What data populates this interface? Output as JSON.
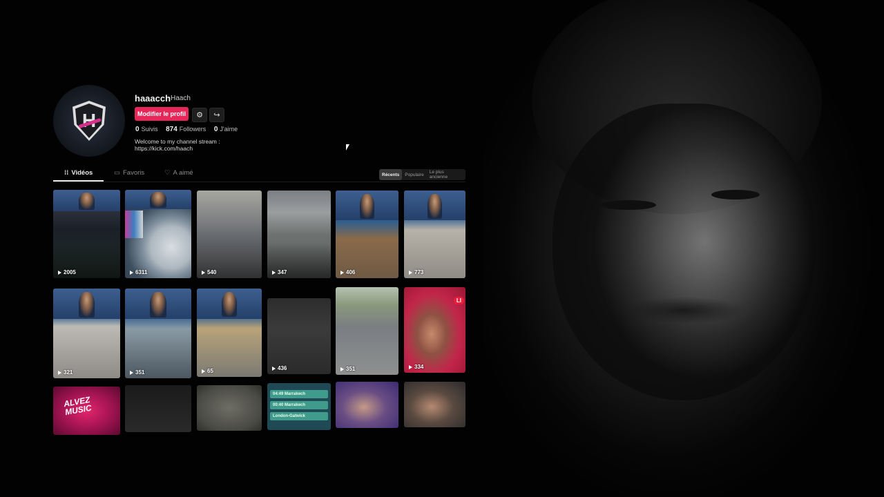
{
  "profile": {
    "username": "haaacch",
    "nickname": "Haach",
    "edit_button": "Modifier le profil",
    "stats": {
      "following_count": "0",
      "following_label": "Suivis",
      "followers_count": "874",
      "followers_label": "Followers",
      "likes_count": "0",
      "likes_label": "J'aime"
    },
    "bio_line1": "Welcome to my channel stream :",
    "bio_line2": "https://kick.com/haach"
  },
  "tabs": [
    {
      "label": "Vidéos",
      "icon": "grid-icon",
      "active": true
    },
    {
      "label": "Favoris",
      "icon": "bookmark-icon",
      "active": false
    },
    {
      "label": "A aimé",
      "icon": "heart-icon",
      "active": false
    }
  ],
  "sort": {
    "options": [
      "Récents",
      "Populaire",
      "Le plus ancienne"
    ],
    "selected": "Récents"
  },
  "videos": [
    {
      "views": "2005"
    },
    {
      "views": "6311"
    },
    {
      "views": "540"
    },
    {
      "views": "347"
    },
    {
      "views": "406"
    },
    {
      "views": "773"
    },
    {
      "views": "321"
    },
    {
      "views": "351"
    },
    {
      "views": "65"
    },
    {
      "views": "436"
    },
    {
      "views": "351"
    },
    {
      "views": "334"
    },
    {
      "views": ""
    },
    {
      "views": ""
    },
    {
      "views": ""
    },
    {
      "views": ""
    },
    {
      "views": ""
    },
    {
      "views": ""
    }
  ],
  "overlays": {
    "live_badge": "LI",
    "alvez_text_1": "ALVEZ",
    "alvez_text_2": "MUSIC",
    "route_1": "04:49 Marrakech",
    "route_2": "00:40 Marrakech",
    "route_3": "London-Gatwick"
  },
  "colors": {
    "accent": "#e7265a",
    "background": "#020202"
  }
}
